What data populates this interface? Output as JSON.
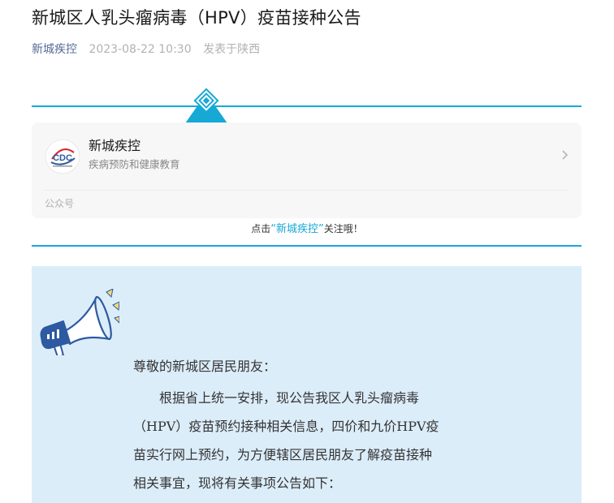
{
  "article": {
    "title": "新城区人乳头瘤病毒（HPV）疫苗接种公告",
    "account": "新城疾控",
    "datetime": "2023-08-22 10:30",
    "location": "发表于陕西"
  },
  "account_card": {
    "name": "新城疾控",
    "description": "疾病预防和健康教育",
    "type_label": "公众号",
    "logo_icon": "cdc-logo-icon",
    "logo_text": "CDC"
  },
  "follow_prompt": {
    "prefix": "点击",
    "account": "“新城疾控”",
    "suffix": "关注哦！"
  },
  "notice": {
    "greeting": "尊敬的新城区居民朋友：",
    "lines": [
      "根据省上统一安排，现公告我区人乳头瘤病毒",
      "（HPV）疫苗预约接种相关信息，四价和九价HPV疫",
      "苗实行网上预约，为方便辖区居民朋友了解疫苗接种",
      "相关事宜，现将有关事项公告如下："
    ]
  },
  "colors": {
    "accent": "#16a9d6",
    "notice_bg": "#dcedfa",
    "account_link": "#576b95",
    "megaphone": "#2d5aa0"
  }
}
